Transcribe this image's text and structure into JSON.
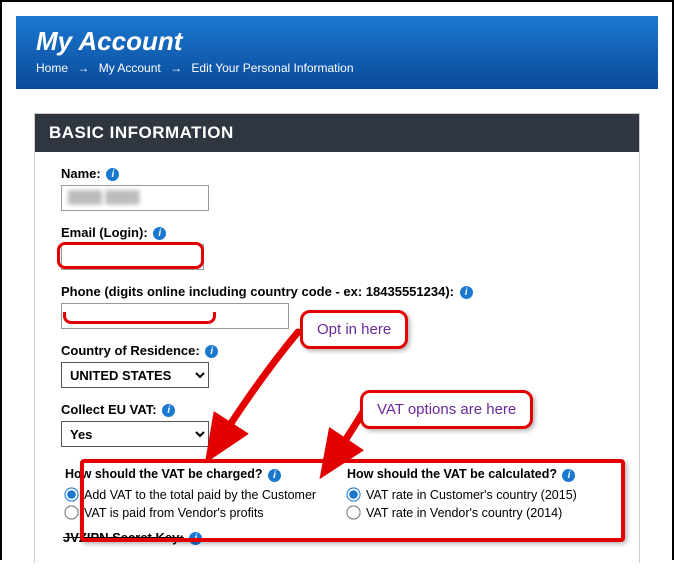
{
  "header": {
    "title": "My Account",
    "breadcrumb": [
      "Home",
      "My Account",
      "Edit Your Personal Information"
    ]
  },
  "section": {
    "title": "BASIC INFORMATION"
  },
  "fields": {
    "name": {
      "label": "Name:",
      "value": ""
    },
    "email": {
      "label": "Email (Login):",
      "value": ""
    },
    "phone": {
      "label": "Phone (digits online including country code - ex: 18435551234):",
      "value": ""
    },
    "country": {
      "label": "Country of Residence:",
      "value": "UNITED STATES"
    },
    "collect_vat": {
      "label": "Collect EU VAT:",
      "value": "Yes"
    }
  },
  "vat_charged": {
    "question": "How should the VAT be charged?",
    "opt1": "Add VAT to the total paid by the Customer",
    "opt2": "VAT is paid from Vendor's profits"
  },
  "vat_calc": {
    "question": "How should the VAT be calculated?",
    "opt1": "VAT rate in Customer's country (2015)",
    "opt2": "VAT rate in Vendor's country (2014)"
  },
  "truncated_line": "JVZIPN Secret Key:",
  "annotations": {
    "opt_in": "Opt in here",
    "vat_options": "VAT options are here"
  }
}
